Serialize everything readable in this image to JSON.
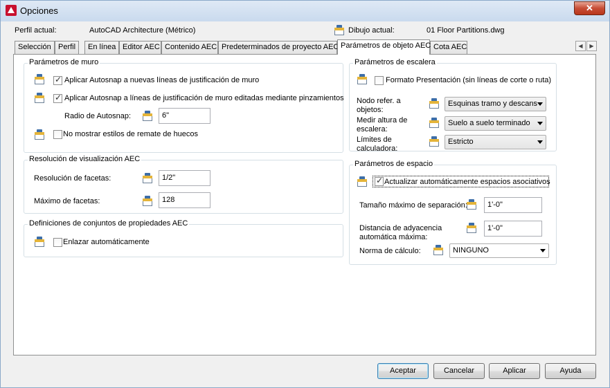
{
  "window": {
    "title": "Opciones",
    "close_label": "✕"
  },
  "profile": {
    "label": "Perfil actual:",
    "value": "AutoCAD Architecture (Métrico)"
  },
  "drawing": {
    "label": "Dibujo actual:",
    "value": "01 Floor Partitions.dwg"
  },
  "tabs": [
    {
      "label": "Selección"
    },
    {
      "label": "Perfil"
    },
    {
      "label": "En línea"
    },
    {
      "label": "Editor AEC"
    },
    {
      "label": "Contenido AEC"
    },
    {
      "label": "Predeterminados de proyecto AEC"
    },
    {
      "label": "Parámetros de objeto AEC",
      "active": true
    },
    {
      "label": "Cota AEC"
    }
  ],
  "wall": {
    "title": "Parámetros de muro",
    "autosnap_new": {
      "label": "Aplicar Autosnap a nuevas líneas de justificación de muro",
      "checked": true
    },
    "autosnap_grip": {
      "label": "Aplicar Autosnap a líneas de justificación de muro editadas mediante pinzamientos",
      "checked": true
    },
    "radius_label": "Radio de Autosnap:",
    "radius_value": "6\"",
    "hide_styles": {
      "label": "No mostrar estilos de remate de huecos",
      "checked": false
    }
  },
  "display": {
    "title": "Resolución de visualización AEC",
    "facet_res_label": "Resolución de facetas:",
    "facet_res_value": "1/2\"",
    "facet_max_label": "Máximo de facetas:",
    "facet_max_value": "128"
  },
  "propsets": {
    "title": "Definiciones de conjuntos de propiedades AEC",
    "auto_link": {
      "label": "Enlazar automáticamente",
      "checked": false
    }
  },
  "stairs": {
    "title": "Parámetros de escalera",
    "presentation": {
      "label": "Formato Presentación (sin líneas de corte o ruta)",
      "checked": false
    },
    "node_label": "Nodo refer. a objetos:",
    "node_value": "Esquinas tramo y descans",
    "height_label": "Medir altura de escalera:",
    "height_value": "Suelo a suelo terminado",
    "limits_label": "Límites de calculadora:",
    "limits_value": "Estricto"
  },
  "space": {
    "title": "Parámetros de espacio",
    "auto_update": {
      "label": "Actualizar automáticamente espacios asociativos",
      "checked": true
    },
    "max_gap_label": "Tamaño máximo de separación:",
    "max_gap_value": "1'-0\"",
    "adjacency_label": "Distancia de adyacencia automática máxima:",
    "adjacency_value": "1'-0\"",
    "calc_label": "Norma de cálculo:",
    "calc_value": "NINGUNO"
  },
  "buttons": {
    "ok": "Aceptar",
    "cancel": "Cancelar",
    "apply": "Aplicar",
    "help": "Ayuda"
  }
}
